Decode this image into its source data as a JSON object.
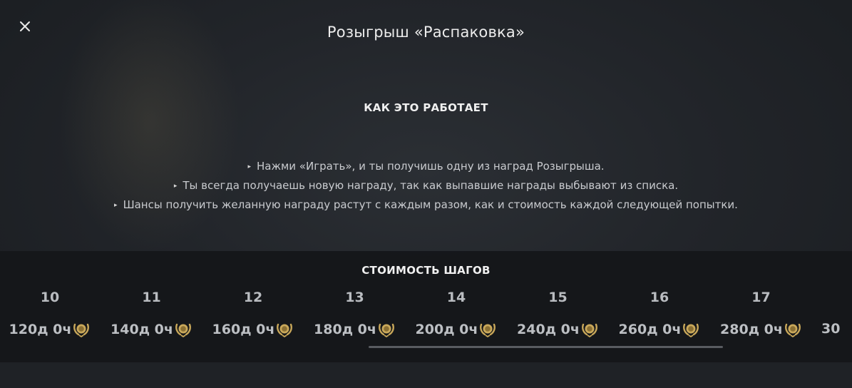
{
  "window": {
    "title": "Розыгрыш «Распаковка»"
  },
  "how_it_works": {
    "heading": "КАК ЭТО РАБОТАЕТ",
    "bullet_glyph": "▸",
    "rules": [
      "Нажми «Играть», и ты получишь одну из наград Розыгрыша.",
      "Ты всегда получаешь новую награду, так как выпавшие награды выбывают из списка.",
      "Шансы получить желанную награду растут с каждым разом, как и стоимость каждой следующей попытки."
    ]
  },
  "steps": {
    "heading": "СТОИМОСТЬ ШАГОВ",
    "items": [
      {
        "number": "10",
        "cost": "120д 0ч"
      },
      {
        "number": "11",
        "cost": "140д 0ч"
      },
      {
        "number": "12",
        "cost": "160д 0ч"
      },
      {
        "number": "13",
        "cost": "180д 0ч"
      },
      {
        "number": "14",
        "cost": "200д 0ч"
      },
      {
        "number": "15",
        "cost": "240д 0ч"
      },
      {
        "number": "16",
        "cost": "260д 0ч"
      },
      {
        "number": "17",
        "cost": "280д 0ч"
      }
    ],
    "next_partial": "30",
    "currency_icon": "gold-laurel-medal-icon"
  },
  "colors": {
    "background": "#1f2226",
    "panel": "#15171a",
    "text": "#e6e6e6",
    "medal_gold": "#c9a85a"
  }
}
